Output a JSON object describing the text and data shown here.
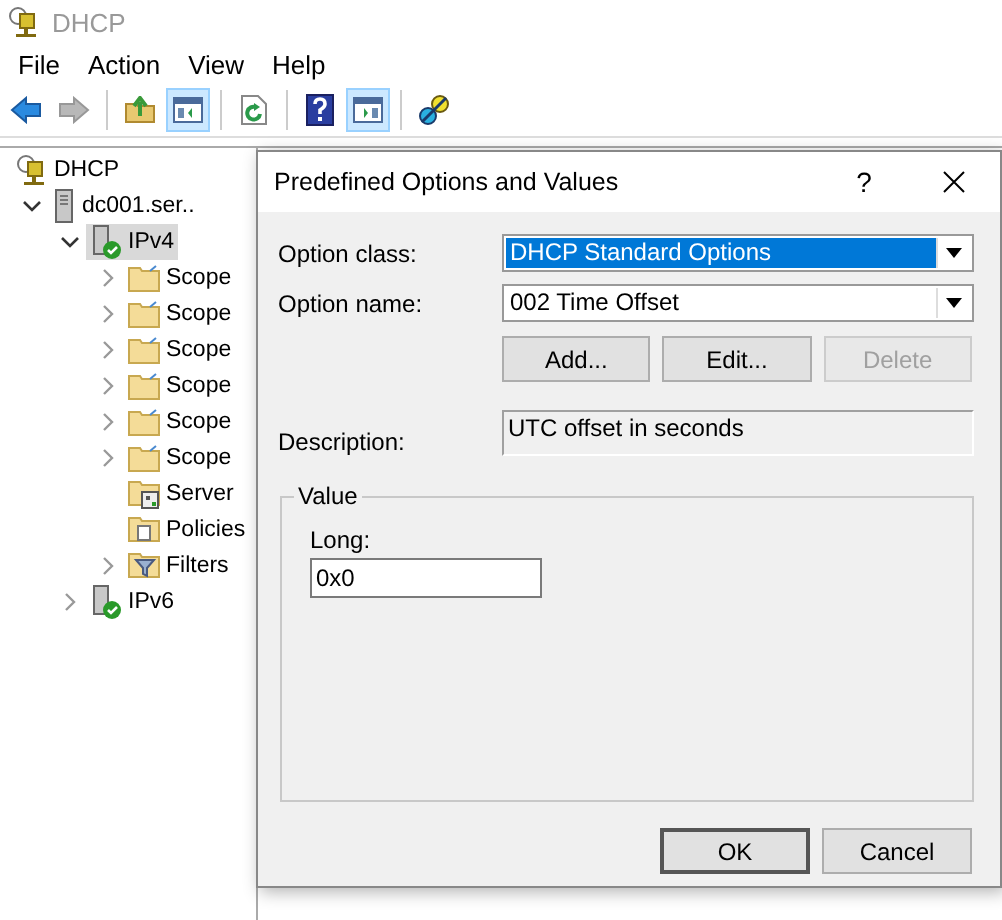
{
  "window": {
    "title": "DHCP"
  },
  "menu": [
    "File",
    "Action",
    "View",
    "Help"
  ],
  "toolbar": [
    {
      "kind": "back",
      "disabled": false,
      "pressed": false
    },
    {
      "kind": "forward",
      "disabled": true,
      "pressed": false
    },
    {
      "kind": "separator"
    },
    {
      "kind": "up",
      "disabled": false,
      "pressed": false
    },
    {
      "kind": "tree-pane",
      "disabled": false,
      "pressed": true
    },
    {
      "kind": "separator"
    },
    {
      "kind": "refresh",
      "disabled": false,
      "pressed": false
    },
    {
      "kind": "separator"
    },
    {
      "kind": "help",
      "disabled": false,
      "pressed": false
    },
    {
      "kind": "action-pane",
      "disabled": false,
      "pressed": true
    },
    {
      "kind": "separator"
    },
    {
      "kind": "plugin",
      "disabled": false,
      "pressed": false
    }
  ],
  "tree": [
    {
      "label": "DHCP",
      "kind": "dhcp",
      "selected": false,
      "children": [
        {
          "label": "dc001.ser..",
          "kind": "server",
          "selected": false,
          "expanded": true,
          "children": [
            {
              "label": "IPv4",
              "kind": "ip",
              "selected": true,
              "expanded": true,
              "children": [
                {
                  "label": "Scope",
                  "kind": "folder",
                  "selected": false,
                  "expanded": false
                },
                {
                  "label": "Scope",
                  "kind": "folder",
                  "selected": false,
                  "expanded": false
                },
                {
                  "label": "Scope",
                  "kind": "folder",
                  "selected": false,
                  "expanded": false
                },
                {
                  "label": "Scope",
                  "kind": "folder",
                  "selected": false,
                  "expanded": false
                },
                {
                  "label": "Scope",
                  "kind": "folder",
                  "selected": false,
                  "expanded": false
                },
                {
                  "label": "Scope",
                  "kind": "folder",
                  "selected": false,
                  "expanded": false
                },
                {
                  "label": "Server",
                  "kind": "server-options",
                  "selected": false
                },
                {
                  "label": "Policies",
                  "kind": "policies",
                  "selected": false
                },
                {
                  "label": "Filters",
                  "kind": "filters",
                  "selected": false,
                  "expanded": false
                }
              ]
            },
            {
              "label": "IPv6",
              "kind": "ip",
              "selected": false,
              "expanded": false
            }
          ]
        }
      ]
    }
  ],
  "dialog": {
    "title": "Predefined Options and Values",
    "help": "?",
    "fields": [
      {
        "label": "Option class:",
        "value": "DHCP Standard Options",
        "highlighted": true
      },
      {
        "label": "Option name:",
        "value": "002 Time Offset",
        "highlighted": false
      }
    ],
    "buttons": [
      {
        "label": "Add...",
        "disabled": false
      },
      {
        "label": "Edit...",
        "disabled": false
      },
      {
        "label": "Delete",
        "disabled": true
      }
    ],
    "description": {
      "label": "Description:",
      "value": "UTC offset in seconds"
    },
    "value_group": {
      "title": "Value",
      "label": "Long:",
      "value": "0x0"
    },
    "footer_buttons": [
      {
        "label": "OK",
        "default": true
      },
      {
        "label": "Cancel",
        "default": false
      }
    ]
  }
}
